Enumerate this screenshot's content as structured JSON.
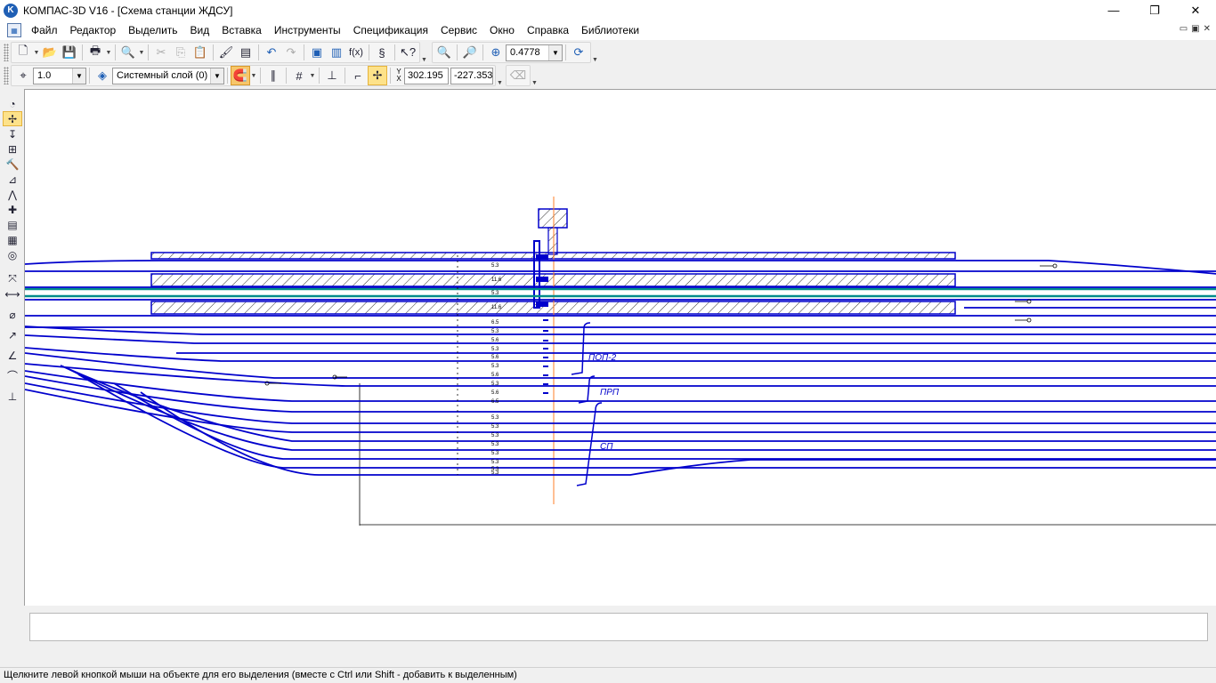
{
  "window": {
    "title": "КОМПАС-3D V16  - [Схема станции ЖДСУ]",
    "minimize": "—",
    "maximize": "❐",
    "close": "✕"
  },
  "menu": {
    "items": [
      "Файл",
      "Редактор",
      "Выделить",
      "Вид",
      "Вставка",
      "Инструменты",
      "Спецификация",
      "Сервис",
      "Окно",
      "Справка",
      "Библиотеки"
    ],
    "mdi": [
      "▭",
      "▣",
      "✕"
    ]
  },
  "toolbar1": {
    "zoom_value": "0.4778"
  },
  "toolbar2": {
    "scale_value": "1.0",
    "layer_value": "Системный слой (0)",
    "x_label": "Y\nX",
    "coord_x": "302.195",
    "coord_y": "-227.353"
  },
  "drawing": {
    "labels": [
      "ПОП-2",
      "ПРП",
      "СП"
    ],
    "colors": {
      "track": "#0000cc",
      "highlight": "#008b8b",
      "axis": "#ff7f27",
      "platform": "#0000cc"
    },
    "track_numbers": [
      "5.3",
      "11.6",
      "5.3",
      "11.6",
      "6.5",
      "5.3",
      "5.6",
      "5.3",
      "5.6",
      "5.3",
      "5.6",
      "5.3",
      "5.6",
      "6.5",
      "5.3",
      "5.3",
      "5.3",
      "5.3",
      "5.3",
      "5.3",
      "5.3",
      "5.3"
    ]
  },
  "status": {
    "text": "Щелкните левой кнопкой мыши на объекте для его выделения (вместе с Ctrl или Shift - добавить к выделенным)"
  }
}
